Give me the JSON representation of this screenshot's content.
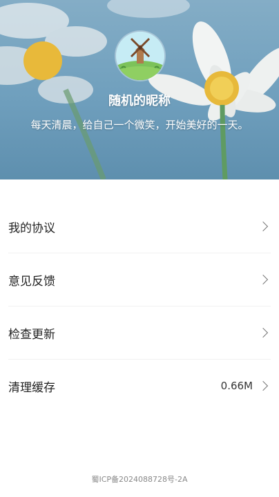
{
  "profile": {
    "nickname": "随机的昵称",
    "motto": "每天清晨，给自己一个微笑，开始美好的一天。"
  },
  "menu": {
    "items": [
      {
        "label": "我的协议",
        "value": ""
      },
      {
        "label": "意见反馈",
        "value": ""
      },
      {
        "label": "检查更新",
        "value": ""
      },
      {
        "label": "清理缓存",
        "value": "0.66M"
      }
    ]
  },
  "footer": {
    "icp": "蜀ICP备2024088728号-2A"
  },
  "icons": {
    "avatar": "windmill-landscape-icon",
    "chevron": "chevron-right-icon"
  },
  "colors": {
    "hero_sky": "#6f9fbd",
    "text_primary": "#222222",
    "footer_text": "#888888"
  }
}
